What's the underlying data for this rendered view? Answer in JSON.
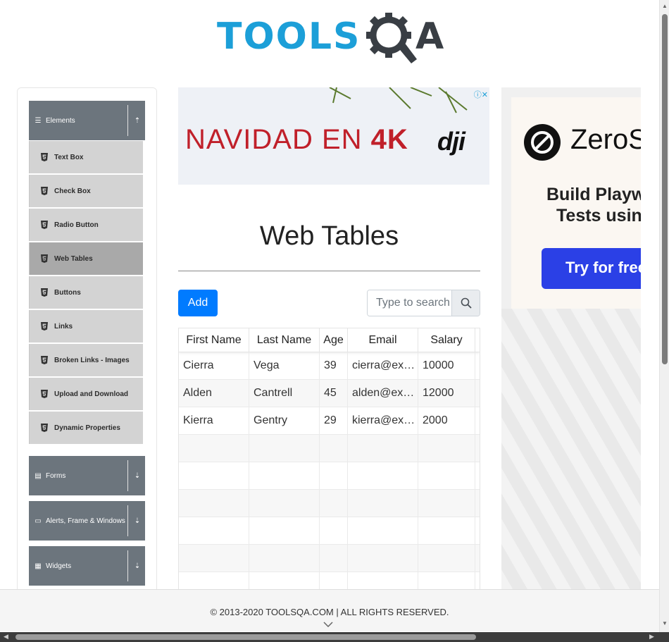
{
  "logo": {
    "part1": "TOOLS",
    "part2": "A",
    "brand_color": "#1c9fd8",
    "dark_color": "#393e44"
  },
  "sidebar": {
    "groups": [
      {
        "label": "Elements",
        "icon": "hamburger-icon",
        "state": "expanded"
      },
      {
        "label": "Forms",
        "icon": "form-icon",
        "state": "collapsed"
      },
      {
        "label": "Alerts, Frame & Windows",
        "icon": "window-icon",
        "state": "collapsed"
      },
      {
        "label": "Widgets",
        "icon": "widgets-icon",
        "state": "collapsed"
      }
    ],
    "items": [
      {
        "label": "Text Box"
      },
      {
        "label": "Check Box"
      },
      {
        "label": "Radio Button"
      },
      {
        "label": "Web Tables",
        "active": true
      },
      {
        "label": "Buttons"
      },
      {
        "label": "Links"
      },
      {
        "label": "Broken Links - Images"
      },
      {
        "label": "Upload and Download"
      },
      {
        "label": "Dynamic Properties"
      }
    ],
    "header_color": "#6c757d",
    "item_color": "#d3d3d3",
    "active_color": "#a9a9a9"
  },
  "ad_top": {
    "text_prefix": "NAVIDAD EN ",
    "text_bold": "4K",
    "brand": "dji"
  },
  "main": {
    "title": "Web Tables",
    "add_label": "Add",
    "search": {
      "placeholder": "Type to search",
      "value": ""
    },
    "table": {
      "headers": [
        "First Name",
        "Last Name",
        "Age",
        "Email",
        "Salary"
      ],
      "rows": [
        [
          "Cierra",
          "Vega",
          "39",
          "cierra@ex…",
          "10000"
        ],
        [
          "Alden",
          "Cantrell",
          "45",
          "alden@ex…",
          "12000"
        ],
        [
          "Kierra",
          "Gentry",
          "29",
          "kierra@ex…",
          "2000"
        ]
      ],
      "empty_rows": 6
    },
    "accent_color": "#007bff"
  },
  "ad_right": {
    "brand": "ZeroSt",
    "line1": "Build Playwri",
    "line2": "Tests using",
    "cta": "Try for free -"
  },
  "footer": {
    "text": "© 2013-2020 TOOLSQA.COM | ALL RIGHTS RESERVED."
  }
}
